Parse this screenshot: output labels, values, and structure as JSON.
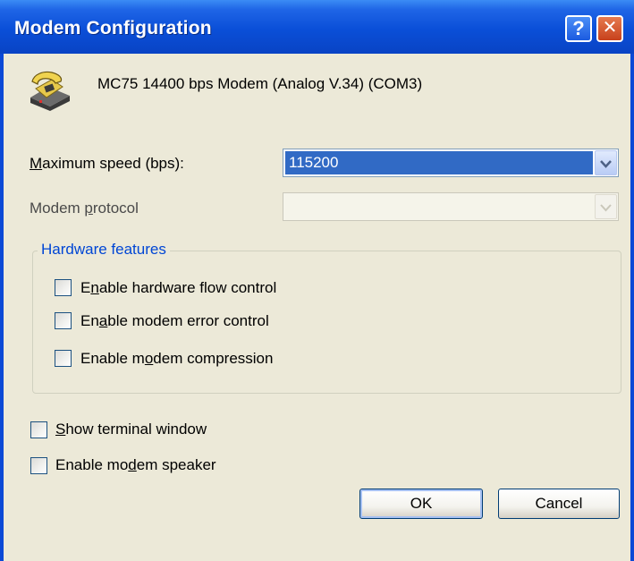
{
  "window": {
    "title": "Modem Configuration",
    "help_glyph": "?",
    "close_glyph": "✕"
  },
  "modem": {
    "icon": "telephone-modem-icon",
    "name": "MC75 14400 bps Modem (Analog V.34) (COM3)"
  },
  "max_speed": {
    "label_pre": "",
    "label_mnemonic": "M",
    "label_post": "aximum speed (bps):",
    "value": "115200",
    "options": [
      "115200"
    ]
  },
  "protocol": {
    "label_pre": "Modem ",
    "label_mnemonic": "p",
    "label_post": "rotocol",
    "value": "",
    "enabled": false
  },
  "hardware": {
    "title": "Hardware features",
    "items": [
      {
        "pre": "E",
        "mnemonic": "n",
        "post": "able hardware flow control",
        "checked": false
      },
      {
        "pre": "En",
        "mnemonic": "a",
        "post": "ble modem error control",
        "checked": false
      },
      {
        "pre": "Enable m",
        "mnemonic": "o",
        "post": "dem compression",
        "checked": false
      }
    ]
  },
  "options": [
    {
      "pre": "",
      "mnemonic": "S",
      "post": "how terminal window",
      "checked": false
    },
    {
      "pre": "Enable mo",
      "mnemonic": "d",
      "post": "em speaker",
      "checked": false
    }
  ],
  "buttons": {
    "ok": "OK",
    "cancel": "Cancel"
  },
  "colors": {
    "titlebar": "#0a4fd8",
    "selection": "#316ac5",
    "dialog_bg": "#ece9d8",
    "group_title": "#0046d5"
  }
}
